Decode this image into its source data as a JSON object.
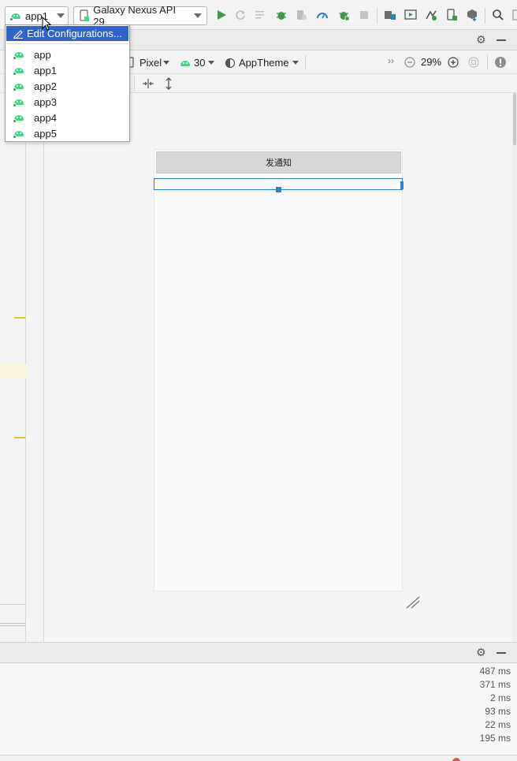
{
  "toolbar": {
    "run_config": "app1",
    "device": "Galaxy Nexus API 29",
    "icons": [
      "run-icon",
      "rerun-icon",
      "apply-changes-icon",
      "debug-icon",
      "attach-debugger-icon",
      "profile-icon",
      "coverage-icon",
      "stop-icon",
      "project-structure-icon",
      "device-manager-icon",
      "sdk-manager-icon",
      "avd-manager-icon",
      "sync-gradle-icon",
      "search-icon"
    ]
  },
  "run_config_menu": {
    "edit_label": "Edit Configurations...",
    "items": [
      "app",
      "app1",
      "app2",
      "app3",
      "app4",
      "app5"
    ]
  },
  "design_toolbar": {
    "device": "Pixel",
    "api": "30",
    "theme": "AppTheme",
    "zoom": "29%",
    "overflow": "››"
  },
  "preview": {
    "button_text": "发通知"
  },
  "bottom_panel": {
    "timings": [
      "487 ms",
      "371 ms",
      "2 ms",
      "93 ms",
      "22 ms",
      "195 ms"
    ]
  },
  "colors": {
    "accent": "#2f65ca",
    "selection": "#2f7fd8",
    "android_green": "#3ddc84",
    "warning_marker": "#e8c33a"
  }
}
